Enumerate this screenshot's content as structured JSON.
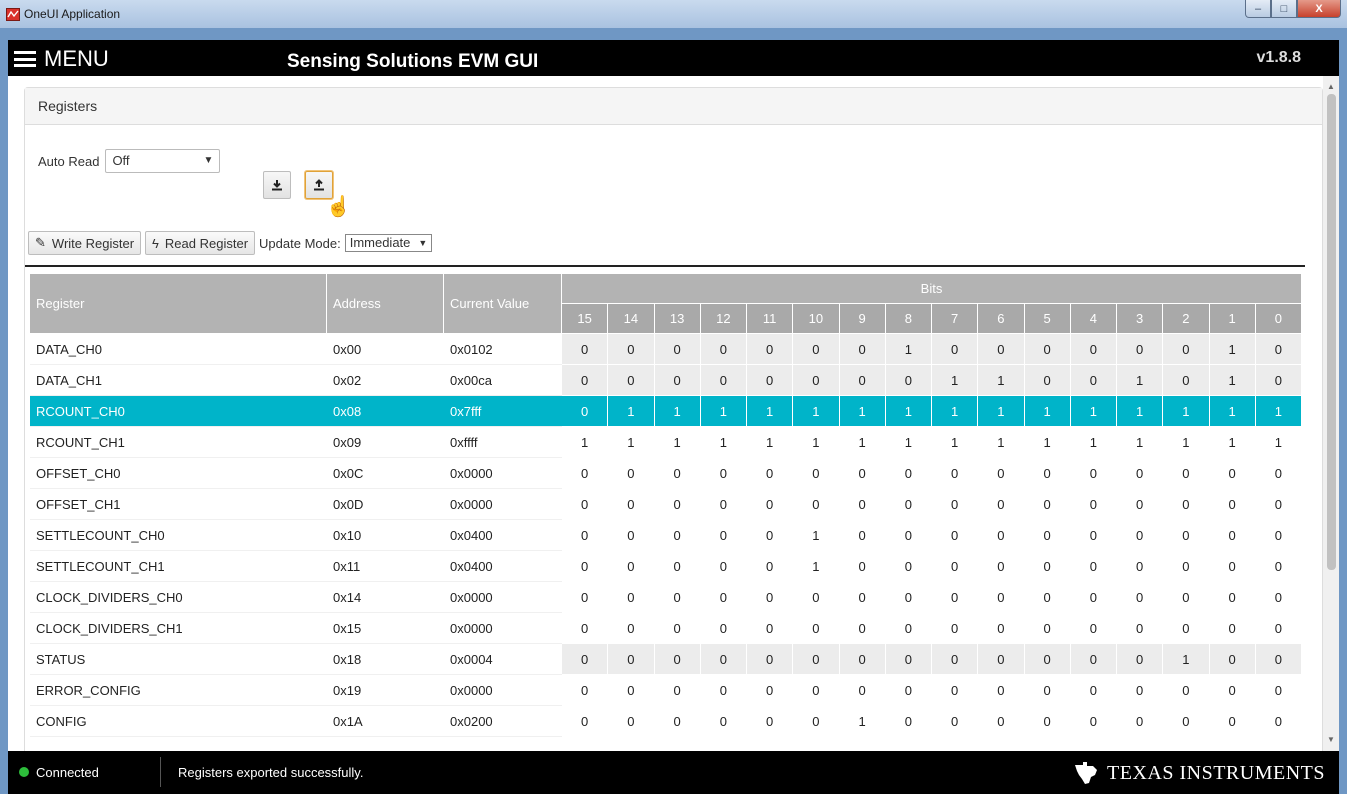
{
  "window": {
    "title": "OneUI Application",
    "controls": [
      "–",
      "□",
      "X"
    ]
  },
  "appbar": {
    "menu_label": "MENU",
    "title": "Sensing Solutions EVM GUI",
    "version": "v1.8.8"
  },
  "panel": {
    "heading": "Registers"
  },
  "auto_read": {
    "label": "Auto Read",
    "value": "Off"
  },
  "toolbar": {
    "write_label": "Write Register",
    "read_label": "Read Register",
    "update_mode_label": "Update Mode:",
    "update_mode_value": "Immediate"
  },
  "table": {
    "headers": {
      "register": "Register",
      "address": "Address",
      "current_value": "Current Value",
      "bits": "Bits"
    },
    "bit_labels": [
      "15",
      "14",
      "13",
      "12",
      "11",
      "10",
      "9",
      "8",
      "7",
      "6",
      "5",
      "4",
      "3",
      "2",
      "1",
      "0"
    ],
    "rows": [
      {
        "name": "DATA_CH0",
        "address": "0x00",
        "value": "0x0102",
        "bits": [
          0,
          0,
          0,
          0,
          0,
          0,
          0,
          1,
          0,
          0,
          0,
          0,
          0,
          0,
          1,
          0
        ],
        "shaded": true
      },
      {
        "name": "DATA_CH1",
        "address": "0x02",
        "value": "0x00ca",
        "bits": [
          0,
          0,
          0,
          0,
          0,
          0,
          0,
          0,
          1,
          1,
          0,
          0,
          1,
          0,
          1,
          0
        ],
        "shaded": true
      },
      {
        "name": "RCOUNT_CH0",
        "address": "0x08",
        "value": "0x7fff",
        "bits": [
          0,
          1,
          1,
          1,
          1,
          1,
          1,
          1,
          1,
          1,
          1,
          1,
          1,
          1,
          1,
          1
        ],
        "selected": true
      },
      {
        "name": "RCOUNT_CH1",
        "address": "0x09",
        "value": "0xffff",
        "bits": [
          1,
          1,
          1,
          1,
          1,
          1,
          1,
          1,
          1,
          1,
          1,
          1,
          1,
          1,
          1,
          1
        ]
      },
      {
        "name": "OFFSET_CH0",
        "address": "0x0C",
        "value": "0x0000",
        "bits": [
          0,
          0,
          0,
          0,
          0,
          0,
          0,
          0,
          0,
          0,
          0,
          0,
          0,
          0,
          0,
          0
        ]
      },
      {
        "name": "OFFSET_CH1",
        "address": "0x0D",
        "value": "0x0000",
        "bits": [
          0,
          0,
          0,
          0,
          0,
          0,
          0,
          0,
          0,
          0,
          0,
          0,
          0,
          0,
          0,
          0
        ]
      },
      {
        "name": "SETTLECOUNT_CH0",
        "address": "0x10",
        "value": "0x0400",
        "bits": [
          0,
          0,
          0,
          0,
          0,
          1,
          0,
          0,
          0,
          0,
          0,
          0,
          0,
          0,
          0,
          0
        ]
      },
      {
        "name": "SETTLECOUNT_CH1",
        "address": "0x11",
        "value": "0x0400",
        "bits": [
          0,
          0,
          0,
          0,
          0,
          1,
          0,
          0,
          0,
          0,
          0,
          0,
          0,
          0,
          0,
          0
        ]
      },
      {
        "name": "CLOCK_DIVIDERS_CH0",
        "address": "0x14",
        "value": "0x0000",
        "bits": [
          0,
          0,
          0,
          0,
          0,
          0,
          0,
          0,
          0,
          0,
          0,
          0,
          0,
          0,
          0,
          0
        ]
      },
      {
        "name": "CLOCK_DIVIDERS_CH1",
        "address": "0x15",
        "value": "0x0000",
        "bits": [
          0,
          0,
          0,
          0,
          0,
          0,
          0,
          0,
          0,
          0,
          0,
          0,
          0,
          0,
          0,
          0
        ]
      },
      {
        "name": "STATUS",
        "address": "0x18",
        "value": "0x0004",
        "bits": [
          0,
          0,
          0,
          0,
          0,
          0,
          0,
          0,
          0,
          0,
          0,
          0,
          0,
          1,
          0,
          0
        ],
        "shaded": true
      },
      {
        "name": "ERROR_CONFIG",
        "address": "0x19",
        "value": "0x0000",
        "bits": [
          0,
          0,
          0,
          0,
          0,
          0,
          0,
          0,
          0,
          0,
          0,
          0,
          0,
          0,
          0,
          0
        ]
      },
      {
        "name": "CONFIG",
        "address": "0x1A",
        "value": "0x0200",
        "bits": [
          0,
          0,
          0,
          0,
          0,
          0,
          1,
          0,
          0,
          0,
          0,
          0,
          0,
          0,
          0,
          0
        ]
      }
    ]
  },
  "status": {
    "connection": "Connected",
    "message": "Registers exported successfully.",
    "logo_text": "TEXAS INSTRUMENTS"
  }
}
